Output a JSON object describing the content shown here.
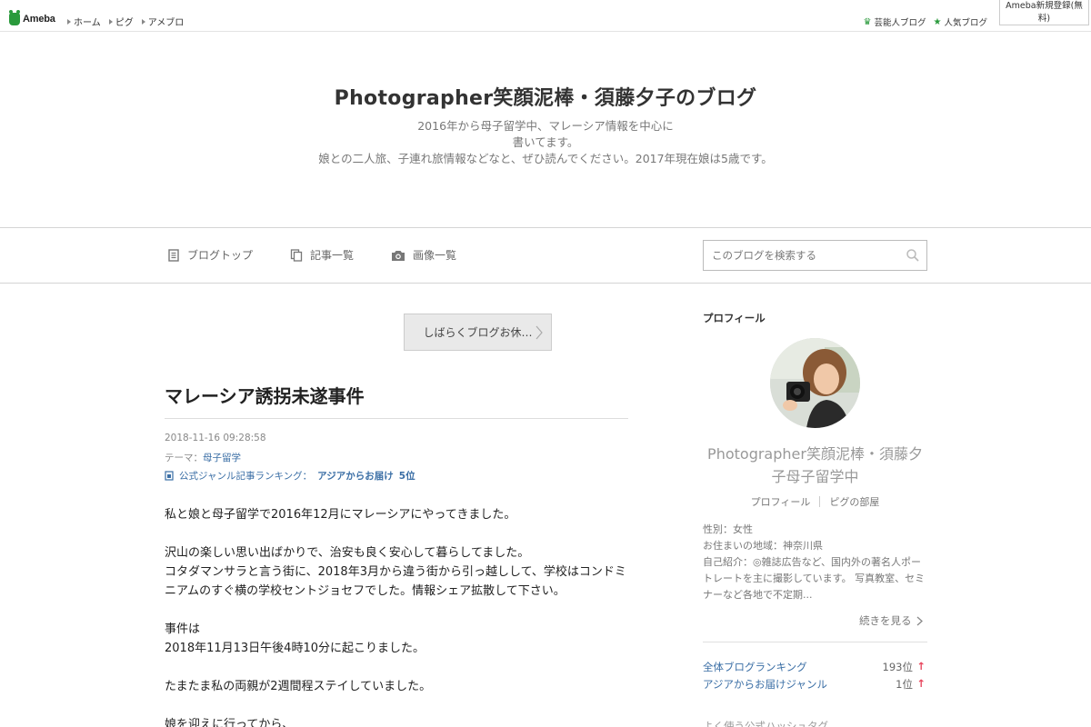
{
  "topbar": {
    "logo": "Ameba",
    "nav": [
      "ホーム",
      "ピグ",
      "アメブロ"
    ],
    "links": [
      {
        "label": "芸能人ブログ",
        "icon": "crown-icon"
      },
      {
        "label": "人気ブログ",
        "icon": "star-icon"
      }
    ],
    "register": "Ameba新規登録(無料)"
  },
  "header": {
    "title": "Photographer笑顔泥棒・須藤夕子のブログ",
    "desc_lines": [
      "2016年から母子留学中、マレーシア情報を中心に",
      "書いてます。",
      "娘との二人旅、子連れ旅情報などなと、ぜひ読んでください。2017年現在娘は5歳です。"
    ]
  },
  "nav": {
    "items": [
      {
        "label": "ブログトップ",
        "icon": "document-icon"
      },
      {
        "label": "記事一覧",
        "icon": "copy-icon"
      },
      {
        "label": "画像一覧",
        "icon": "camera-icon"
      }
    ],
    "search_placeholder": "このブログを検索する"
  },
  "article": {
    "notice": "しばらくブログお休…",
    "title": "マレーシア誘拐未遂事件",
    "date": "2018-11-16 09:28:58",
    "theme_prefix": "テーマ：",
    "theme": "母子留学",
    "ranking_prefix": "公式ジャンル記事ランキング：",
    "ranking_genre": "アジアからお届け",
    "ranking_rank": "5位",
    "body": [
      "私と娘と母子留学で2016年12月にマレーシアにやってきました。",
      "沢山の楽しい思い出ばかりで、治安も良く安心して暮らしてました。",
      "コタダマンサラと言う街に、2018年3月から違う街から引っ越しして、学校はコンドミニアムのすぐ横の学校セントジョセフでした。情報シェア拡散して下さい。",
      "事件は",
      "2018年11月13日午後4時10分に起こりました。",
      "たまたま私の両親が2週間程ステイしていました。",
      "娘を迎えに行ってから、"
    ]
  },
  "sidebar": {
    "heading": "プロフィール",
    "name": "Photographer笑顔泥棒・須藤夕子母子留学中",
    "links": [
      "プロフィール",
      "ピグの部屋"
    ],
    "gender": "性別：女性",
    "location": "お住まいの地域：神奈川県",
    "intro": "自己紹介：◎雑誌広告など、国内外の著名人ポートレートを主に撮影しています。 写真教室、セミナーなど各地で不定期...",
    "more": "続きを見る",
    "rankings": [
      {
        "label": "全体ブログランキング",
        "value": "193位"
      },
      {
        "label": "アジアからお届けジャンル",
        "value": "1位"
      }
    ],
    "up_mark": "↑",
    "hashtag_heading": "よく使う公式ハッシュタグ"
  },
  "colors": {
    "ameba_green": "#2a9a3c",
    "link_blue": "#3a6ea5",
    "rank_up_red": "#e8475e"
  }
}
